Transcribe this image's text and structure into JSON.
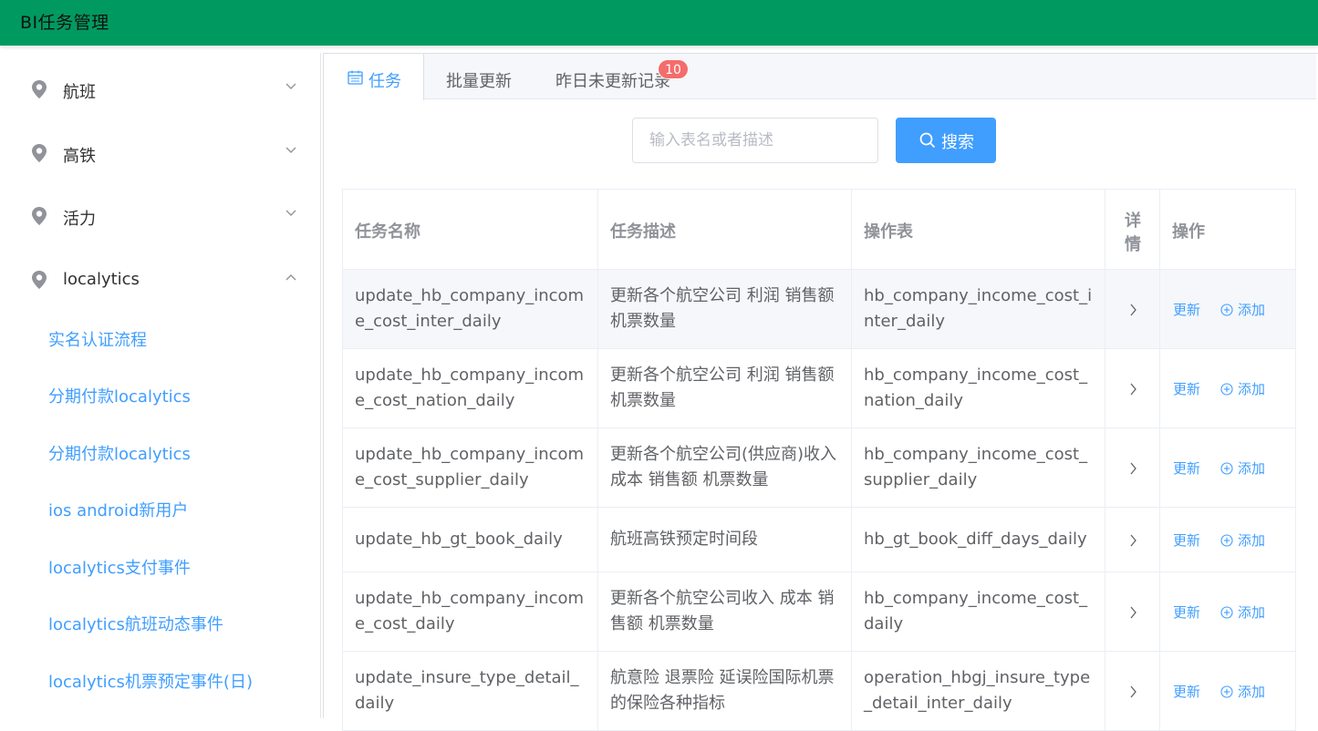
{
  "app": {
    "title": "BI任务管理",
    "accent": "#409eff",
    "header_color": "#009a61"
  },
  "sidebar": {
    "groups": [
      {
        "label": "航班",
        "icon": "location-pin-icon",
        "expanded": false
      },
      {
        "label": "高铁",
        "icon": "location-pin-icon",
        "expanded": false
      },
      {
        "label": "活力",
        "icon": "location-pin-icon",
        "expanded": false
      },
      {
        "label": "localytics",
        "icon": "location-pin-icon",
        "expanded": true
      }
    ],
    "sub_items": [
      {
        "label": "实名认证流程"
      },
      {
        "label": "分期付款localytics"
      },
      {
        "label": "分期付款localytics"
      },
      {
        "label": "ios android新用户"
      },
      {
        "label": "localytics支付事件"
      },
      {
        "label": "localytics航班动态事件"
      },
      {
        "label": "localytics机票预定事件(日)"
      }
    ]
  },
  "tabs": [
    {
      "label": "任务",
      "active": true,
      "icon": "calendar-icon"
    },
    {
      "label": "批量更新",
      "active": false
    },
    {
      "label": "昨日未更新记录",
      "active": false,
      "badge": "10"
    }
  ],
  "search": {
    "placeholder": "输入表名或者描述",
    "value": "",
    "button_label": "搜索"
  },
  "table": {
    "headers": [
      "任务名称",
      "任务描述",
      "操作表",
      "详情",
      "操作"
    ],
    "detail_header_lines": [
      "详",
      "情"
    ],
    "rows": [
      {
        "name": "update_hb_company_income_cost_inter_daily",
        "desc": "更新各个航空公司 利润 销售额 机票数量",
        "table": "hb_company_income_cost_inter_daily",
        "update": "更新",
        "add": "添加"
      },
      {
        "name": "update_hb_company_income_cost_nation_daily",
        "desc": "更新各个航空公司 利润 销售额 机票数量",
        "table": "hb_company_income_cost_nation_daily",
        "update": "更新",
        "add": "添加"
      },
      {
        "name": "update_hb_company_income_cost_supplier_daily",
        "desc": "更新各个航空公司(供应商)收入 成本 销售额 机票数量",
        "table": "hb_company_income_cost_supplier_daily",
        "update": "更新",
        "add": "添加"
      },
      {
        "name": "update_hb_gt_book_daily",
        "desc": "航班高铁预定时间段",
        "table": "hb_gt_book_diff_days_daily",
        "update": "更新",
        "add": "添加"
      },
      {
        "name": "update_hb_company_income_cost_daily",
        "desc": "更新各个航空公司收入 成本 销售额 机票数量",
        "table": "hb_company_income_cost_daily",
        "update": "更新",
        "add": "添加"
      },
      {
        "name": "update_insure_type_detail_daily",
        "desc": "航意险 退票险 延误险国际机票的保险各种指标",
        "table": "operation_hbgj_insure_type_detail_inter_daily",
        "update": "更新",
        "add": "添加"
      }
    ]
  }
}
